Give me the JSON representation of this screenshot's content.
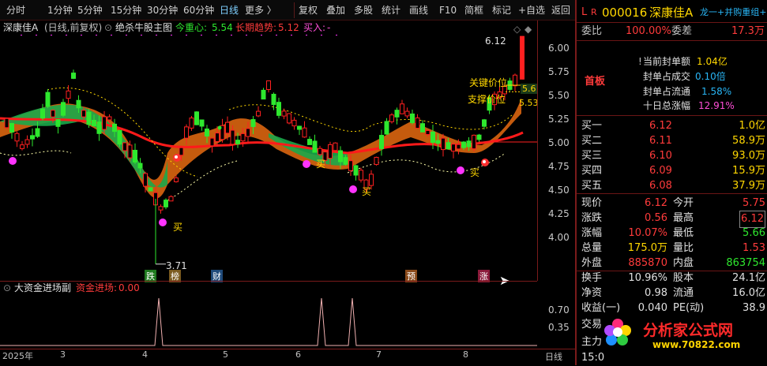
{
  "toolbar": {
    "items": [
      "分时",
      "1分钟",
      "5分钟",
      "15分钟",
      "30分钟",
      "60分钟",
      "日线",
      "更多 〉",
      "复权",
      "叠加",
      "多股",
      "统计",
      "画线",
      "F10",
      "简框",
      "标记",
      "+自选",
      "返回"
    ],
    "active": "日线"
  },
  "title": {
    "stock": "深康佳A",
    "mode": "(日线,前复权)",
    "indicator": "绝杀牛股主图",
    "center_label": "今重心:",
    "center_val": "5.54",
    "trend_label": "长期趋势:",
    "trend_val": "5.12",
    "buy_label": "买入:",
    "buy_val": "-"
  },
  "price_axis": [
    "6.00",
    "5.75",
    "5.50",
    "5.25",
    "5.00",
    "4.75",
    "4.50",
    "4.25",
    "4.00"
  ],
  "chart_labels": {
    "high": "6.12",
    "low": "3.71",
    "key": "关键价位",
    "support": "支撑价位",
    "key_tag": "5.6",
    "sup_tag": "5.53",
    "buy": "买"
  },
  "event_tags": [
    "跌",
    "榜",
    "财",
    "预",
    "涨"
  ],
  "sub": {
    "title": "大资金进场副",
    "label": "资金进场:",
    "value": "0.00",
    "axis": [
      "0.70",
      "0.35"
    ]
  },
  "xaxis": {
    "labels": [
      "2025年",
      "3",
      "4",
      "5",
      "6",
      "7",
      "8"
    ],
    "period": "日线"
  },
  "panel": {
    "code": "000016",
    "name": "深康佳A",
    "tag": "龙一+并购重组+",
    "weibi_label": "委比",
    "weibi": "100.00%",
    "weicha_label": "委差",
    "weicha": "17.3万",
    "board": "首板",
    "seal": [
      {
        "label": "当前封单额",
        "value": "1.04亿"
      },
      {
        "label": "封单占成交",
        "value": "0.10倍"
      },
      {
        "label": "封单占流通",
        "value": "1.58%"
      },
      {
        "label": "十日总涨幅",
        "value": "12.91%"
      }
    ],
    "bids": [
      {
        "label": "买一",
        "price": "6.12",
        "vol": "1.0亿"
      },
      {
        "label": "买二",
        "price": "6.11",
        "vol": "58.9万"
      },
      {
        "label": "买三",
        "price": "6.10",
        "vol": "93.0万"
      },
      {
        "label": "买四",
        "price": "6.09",
        "vol": "15.9万"
      },
      {
        "label": "买五",
        "price": "6.08",
        "vol": "37.9万"
      }
    ],
    "quote": [
      {
        "l1": "现价",
        "v1": "6.12",
        "l2": "今开",
        "v2": "5.75"
      },
      {
        "l1": "涨跌",
        "v1": "0.56",
        "l2": "最高",
        "v2": "6.12"
      },
      {
        "l1": "涨幅",
        "v1": "10.07%",
        "l2": "最低",
        "v2": "5.66"
      },
      {
        "l1": "总量",
        "v1": "175.0万",
        "l2": "量比",
        "v2": "1.53"
      },
      {
        "l1": "外盘",
        "v1": "885870",
        "l2": "内盘",
        "v2": "863754"
      }
    ],
    "fund": [
      {
        "l1": "换手",
        "v1": "10.96%",
        "l2": "股本",
        "v2": "24.1亿"
      },
      {
        "l1": "净资",
        "v1": "0.98",
        "l2": "流通",
        "v2": "16.0亿"
      },
      {
        "l1": "收益(一)",
        "v1": "0.040",
        "l2": "PE(动)",
        "v2": "38.9"
      }
    ],
    "tail": [
      "交易",
      "主力",
      "15:0"
    ],
    "watermark": "分析家公式网",
    "watermark_url": "www.70822.com"
  }
}
